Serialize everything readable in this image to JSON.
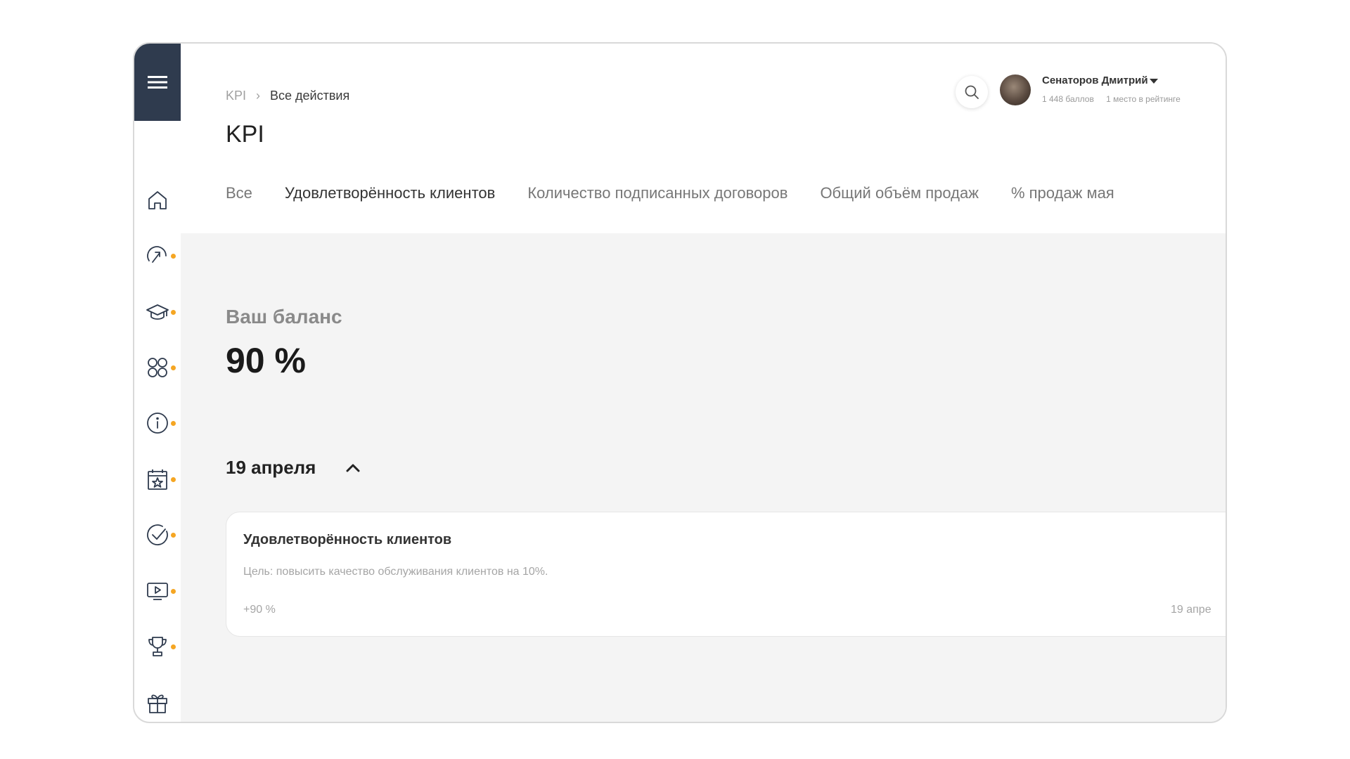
{
  "sidebar": {
    "menu_icon": "hamburger-icon",
    "items": [
      {
        "icon": "home-icon",
        "dot": false
      },
      {
        "icon": "speedometer-icon",
        "dot": true
      },
      {
        "icon": "graduation-cap-icon",
        "dot": true
      },
      {
        "icon": "apps-icon",
        "dot": true
      },
      {
        "icon": "info-icon",
        "dot": true
      },
      {
        "icon": "calendar-star-icon",
        "dot": true
      },
      {
        "icon": "check-circle-icon",
        "dot": true
      },
      {
        "icon": "video-icon",
        "dot": true
      },
      {
        "icon": "trophy-icon",
        "dot": true
      },
      {
        "icon": "gift-icon",
        "dot": false
      },
      {
        "icon": "users-icon",
        "dot": false
      }
    ],
    "dot_color": "#f5a623",
    "menu_bg": "#2f3b4e"
  },
  "breadcrumb": {
    "root": "KPI",
    "current": "Все действия"
  },
  "page_title": "KPI",
  "tabs": [
    {
      "label": "Все",
      "active": false
    },
    {
      "label": "Удовлетворённость клиентов",
      "active": true
    },
    {
      "label": "Количество подписанных договоров",
      "active": false
    },
    {
      "label": "Общий объём продаж",
      "active": false
    },
    {
      "label": "% продаж мая",
      "active": false
    }
  ],
  "user": {
    "name": "Сенаторов Дмитрий",
    "points": "1 448 баллов",
    "rank": "1 место в рейтинге"
  },
  "balance": {
    "label": "Ваш баланс",
    "value": "90 %"
  },
  "date_group": {
    "label": "19 апреля",
    "expanded": true
  },
  "card": {
    "title": "Удовлетворённость клиентов",
    "description": "Цель: повысить качество обслуживания клиентов на 10%.",
    "delta": "+90 %",
    "date": "19 апре"
  }
}
